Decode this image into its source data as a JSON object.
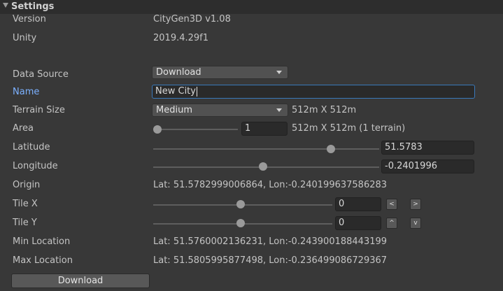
{
  "section": {
    "title": "Settings"
  },
  "rows": {
    "version": {
      "label": "Version",
      "value": "CityGen3D v1.08"
    },
    "unity": {
      "label": "Unity",
      "value": "2019.4.29f1"
    },
    "data_source": {
      "label": "Data Source",
      "value": "Download"
    },
    "name": {
      "label": "Name",
      "value": "New City"
    },
    "terrain_size": {
      "label": "Terrain Size",
      "value": "Medium",
      "info": "512m X 512m"
    },
    "area": {
      "label": "Area",
      "value": "1",
      "info": "512m X 512m (1 terrain)",
      "slider_fraction": 0.0
    },
    "latitude": {
      "label": "Latitude",
      "value": "51.5783",
      "slider_fraction": 0.8
    },
    "longitude": {
      "label": "Longitude",
      "value": "-0.2401996",
      "slider_fraction": 0.5
    },
    "origin": {
      "label": "Origin",
      "value": "Lat: 51.5782999006864, Lon:-0.240199637586283"
    },
    "tile_x": {
      "label": "Tile X",
      "value": "0",
      "slider_fraction": 0.5,
      "btn_left": "<",
      "btn_right": ">"
    },
    "tile_y": {
      "label": "Tile Y",
      "value": "0",
      "slider_fraction": 0.5,
      "btn_up": "^",
      "btn_down": "v"
    },
    "min_location": {
      "label": "Min Location",
      "value": "Lat: 51.5760002136231, Lon:-0.243900188443199"
    },
    "max_location": {
      "label": "Max Location",
      "value": "Lat: 51.5805995877498, Lon:-0.236499086729367"
    }
  },
  "download_button": {
    "label": "Download"
  },
  "colors": {
    "background": "#383838",
    "header_band": "#2d2d2d",
    "focus_label": "#7cb1ff",
    "focus_border": "#3a79bb"
  }
}
